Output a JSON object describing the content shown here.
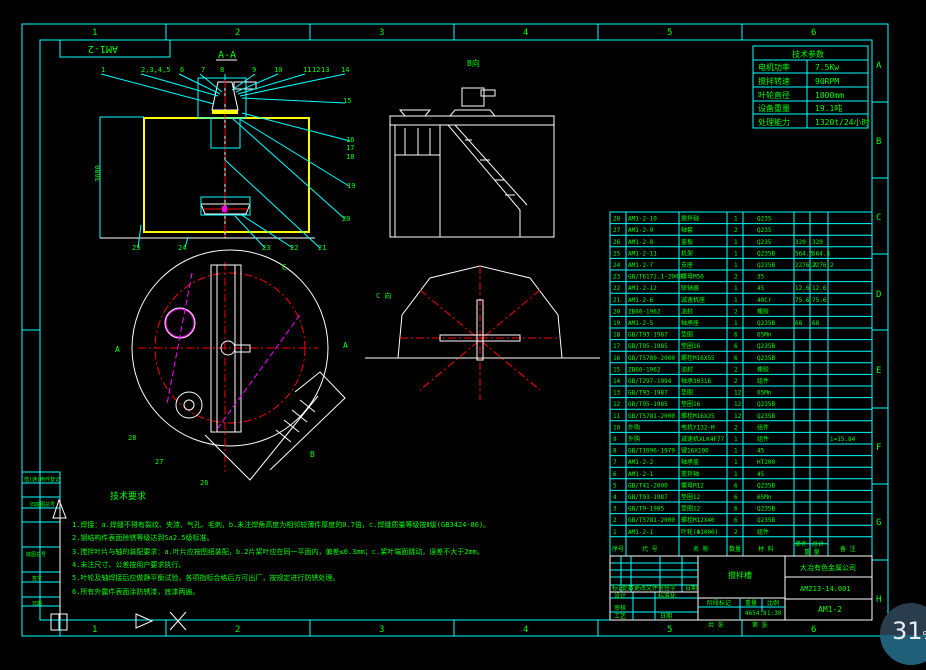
{
  "frame": {
    "columns": [
      "1",
      "2",
      "3",
      "4",
      "5",
      "6"
    ],
    "rows": [
      "A",
      "B",
      "C",
      "D",
      "E",
      "F",
      "G",
      "H"
    ]
  },
  "drawing_code_rotated": "AM1-2",
  "views": {
    "section_title": "A-A",
    "view_c_label": "C",
    "view_c_dir": "C 向",
    "section_marker_a": "A",
    "view_b_marker": "B",
    "side_view_title": "B向"
  },
  "callouts": [
    "1",
    "2,3,4,5",
    "6",
    "7",
    "8",
    "9",
    "10",
    "11",
    "12",
    "13",
    "14",
    "15",
    "16",
    "17",
    "18",
    "19",
    "20",
    "21",
    "22",
    "23",
    "24",
    "25",
    "26",
    "27",
    "28"
  ],
  "dimension_height": "3600",
  "params": {
    "title": "技术参数",
    "rows": [
      {
        "label": "电机功率",
        "value": "7.5Kw"
      },
      {
        "label": "搅拌转速",
        "value": "90RPM"
      },
      {
        "label": "叶轮直径",
        "value": "1000mm"
      },
      {
        "label": "设备重量",
        "value": "19.1吨"
      },
      {
        "label": "处理能力",
        "value": "1320t/24小时"
      }
    ]
  },
  "bom": {
    "rows": [
      [
        "28",
        "AM1-2-10",
        "搅拌轴",
        "1",
        "Q235",
        "",
        "",
        ""
      ],
      [
        "27",
        "AM1-2-9",
        "轴套",
        "2",
        "Q235",
        "",
        "",
        ""
      ],
      [
        "26",
        "AM1-2-8",
        "盖板",
        "1",
        "Q235",
        "320",
        "320",
        ""
      ],
      [
        "25",
        "AM1-2-11",
        "机架",
        "1",
        "Q235B",
        "564.5",
        "564.5",
        ""
      ],
      [
        "24",
        "AM1-2-7",
        "支座",
        "1",
        "Q235B",
        "2276.2",
        "2276.2",
        ""
      ],
      [
        "23",
        "GB/T6172.1-2000",
        "螺母M56",
        "2",
        "35",
        "",
        "",
        ""
      ],
      [
        "22",
        "AM1-2-12",
        "联轴器",
        "1",
        "45",
        "12.6",
        "12.6",
        ""
      ],
      [
        "21",
        "AM1-2-6",
        "减速机座",
        "1",
        "40Cr",
        "75.6",
        "75.6",
        ""
      ],
      [
        "20",
        "ZB60-1962",
        "油封",
        "2",
        "橡胶",
        "",
        "",
        ""
      ],
      [
        "19",
        "AM1-2-5",
        "轴承座",
        "1",
        "Q235B",
        "68",
        "68",
        ""
      ],
      [
        "18",
        "GB/T93-1987",
        "垫圈",
        "6",
        "65Mn",
        "",
        "",
        ""
      ],
      [
        "17",
        "GB/T95-1985",
        "垫圈16",
        "6",
        "Q235B",
        "",
        "",
        ""
      ],
      [
        "16",
        "GB/T5780-2000",
        "螺栓M16X55",
        "6",
        "Q235B",
        "",
        "",
        ""
      ],
      [
        "15",
        "ZB60-1962",
        "油封",
        "2",
        "橡胶",
        "",
        "",
        ""
      ],
      [
        "14",
        "GB/T297-1994",
        "轴承30316",
        "2",
        "组件",
        "",
        "",
        ""
      ],
      [
        "13",
        "GB/T93-1987",
        "垫圈",
        "12",
        "65Mn",
        "",
        "",
        ""
      ],
      [
        "12",
        "GB/T95-1985",
        "垫圈16",
        "12",
        "Q235B",
        "",
        "",
        ""
      ],
      [
        "11",
        "GB/T5781-2000",
        "螺栓M16X25",
        "12",
        "Q235B",
        "",
        "",
        ""
      ],
      [
        "10",
        "外购",
        "电机Y132-M",
        "2",
        "组件",
        "",
        "",
        ""
      ],
      [
        "9",
        "外购",
        "减速机XLK4F77",
        "1",
        "组件",
        "",
        "",
        "i=15.84"
      ],
      [
        "8",
        "GB/T1096-1979",
        "键16X100",
        "1",
        "45",
        "",
        "",
        ""
      ],
      [
        "7",
        "AM1-2-2",
        "轴承盖",
        "1",
        "HT200",
        "",
        "",
        ""
      ],
      [
        "6",
        "AM1-2-1",
        "搅拌轴",
        "1",
        "45",
        "",
        "",
        ""
      ],
      [
        "5",
        "GB/T41-2000",
        "螺母M12",
        "6",
        "Q235B",
        "",
        "",
        ""
      ],
      [
        "4",
        "GB/T93-1987",
        "垫圈12",
        "6",
        "65Mn",
        "",
        "",
        ""
      ],
      [
        "3",
        "GB/T9-1985",
        "垫圈12",
        "6",
        "Q235B",
        "",
        "",
        ""
      ],
      [
        "2",
        "GB/T5781-2000",
        "螺栓M12X40",
        "6",
        "Q235B",
        "",
        "",
        ""
      ],
      [
        "1",
        "AM1-2-1",
        "叶轮(Φ1000)",
        "2",
        "组件",
        "",
        "",
        ""
      ]
    ],
    "header": {
      "no": "序号",
      "code": "代 号",
      "name": "名 称",
      "qty": "数量",
      "material": "材 料",
      "unit": "单件",
      "total": "总计",
      "weight": "重 量",
      "remark": "备 注"
    }
  },
  "notes": {
    "title": "技术要求",
    "lines": [
      "1.焊接：a.焊缝不得有裂纹、夹渣、气孔、毛刺，b.未注焊角高度为相邻较薄件厚度的0.7倍，c.焊缝质量等级按Ⅱ级(GB3424-86)。",
      "2.钢结构件表面除锈等级达到Sa2.5级标准。",
      "3.搅拌叶片与轴的装配要求：a.叶片应按图纸装配，b.2片桨叶应在同一平面内，偏差≤0.3mm；c.桨叶端面跳动，误差不大于2mm。",
      "4.未注尺寸、公差按用户要求执行。",
      "5.叶轮及轴焊接后应做静平衡试验，各项指标合格后方可出厂，按规定进行防锈处理。",
      "6.所有外露件表面涂防锈漆，底漆两遍。"
    ]
  },
  "title_block": {
    "name": "搅拌槽",
    "company": "大冶有色金属公司",
    "drawing_no": "AMZ13-14.001",
    "code": "AM1-2",
    "labels": {
      "mark": "标记",
      "count": "处数",
      "file": "更改文件号",
      "sign": "签字",
      "date": "日期",
      "design": "设计",
      "check": "审核",
      "approve": "工艺",
      "std": "标准化",
      "stage": "阶段标记",
      "weight": "重量",
      "scale": "比例",
      "sheets": "共  张",
      "sheet": "第  张"
    },
    "weight": "4654.8",
    "scale": "1:30"
  },
  "left_column": [
    "借(通)用件登记",
    "旧底图总号",
    "底图总号",
    "签字",
    "日期"
  ],
  "badge": {
    "value": "31",
    "unit": "%"
  }
}
